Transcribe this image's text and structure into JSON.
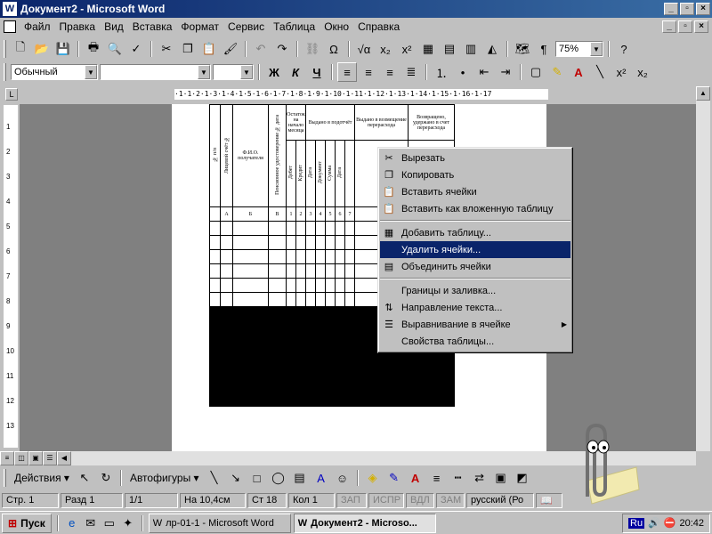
{
  "window": {
    "title": "Документ2 - Microsoft Word"
  },
  "menu": [
    "Файл",
    "Правка",
    "Вид",
    "Вставка",
    "Формат",
    "Сервис",
    "Таблица",
    "Окно",
    "Справка"
  ],
  "standard_toolbar": {
    "zoom": "75%"
  },
  "formatting_toolbar": {
    "style": "Обычный",
    "font": "",
    "size": "",
    "bold": "Ж",
    "italic": "К",
    "underline": "Ч"
  },
  "ruler": {
    "text": "·1·1·2·1·3·1·4·1·5·1·6·1·7·1·8·1·9·1·10·1·11·1·12·1·13·1·14·1·15·1·16·1·17"
  },
  "vruler": [
    "1",
    "2",
    "3",
    "4",
    "5",
    "6",
    "7",
    "8",
    "9",
    "10",
    "11",
    "12",
    "13"
  ],
  "table": {
    "header_vertical": [
      "№ п/п",
      "Лицевой счёт №",
      "Ф.И.О. получателя",
      "Пенсионное удостоверение № дата"
    ],
    "head_remainder": "Остаток на начало месяца",
    "head_issued": "Выдано в подотчёт",
    "head_exchange": "Выдано в возмещение перерасхода",
    "head_returned": "Возвращено, удержано в счет перерасхода",
    "sub_vertical": [
      "Дебет",
      "Кредит",
      "Дата",
      "Документ",
      "Сумма",
      "Дата"
    ],
    "col_labels": [
      "А",
      "Б",
      "В",
      "1",
      "2",
      "3",
      "4",
      "5",
      "6",
      "7"
    ]
  },
  "context_menu": [
    {
      "label": "Вырезать",
      "icon": "scissors-icon"
    },
    {
      "label": "Копировать",
      "icon": "copy-icon"
    },
    {
      "label": "Вставить ячейки",
      "icon": "paste-icon"
    },
    {
      "label": "Вставить как вложенную таблицу",
      "icon": "paste-icon"
    },
    {
      "label": "Добавить таблицу...",
      "icon": "table-icon"
    },
    {
      "label": "Удалить ячейки...",
      "icon": "",
      "highlighted": true
    },
    {
      "label": "Объединить ячейки",
      "icon": "merge-icon"
    },
    {
      "label": "Границы и заливка...",
      "icon": ""
    },
    {
      "label": "Направление текста...",
      "icon": "text-direction-icon"
    },
    {
      "label": "Выравнивание в ячейке",
      "icon": "align-icon",
      "submenu": true
    },
    {
      "label": "Свойства таблицы...",
      "icon": ""
    }
  ],
  "drawing_toolbar": {
    "actions": "Действия ▾",
    "autoshapes": "Автофигуры ▾"
  },
  "status_bar": {
    "page": "Стр. 1",
    "section": "Разд 1",
    "pages": "1/1",
    "position": "На 10,4см",
    "line": "Ст 18",
    "column": "Кол 1",
    "rec": "ЗАП",
    "trk": "ИСПР",
    "ext": "ВДЛ",
    "ovr": "ЗАМ",
    "lang": "русский (Ро"
  },
  "taskbar": {
    "start": "Пуск",
    "tasks": [
      "лр-01-1 - Microsoft Word",
      "Документ2 - Microso..."
    ],
    "lang": "Ru",
    "time": "20:42"
  }
}
